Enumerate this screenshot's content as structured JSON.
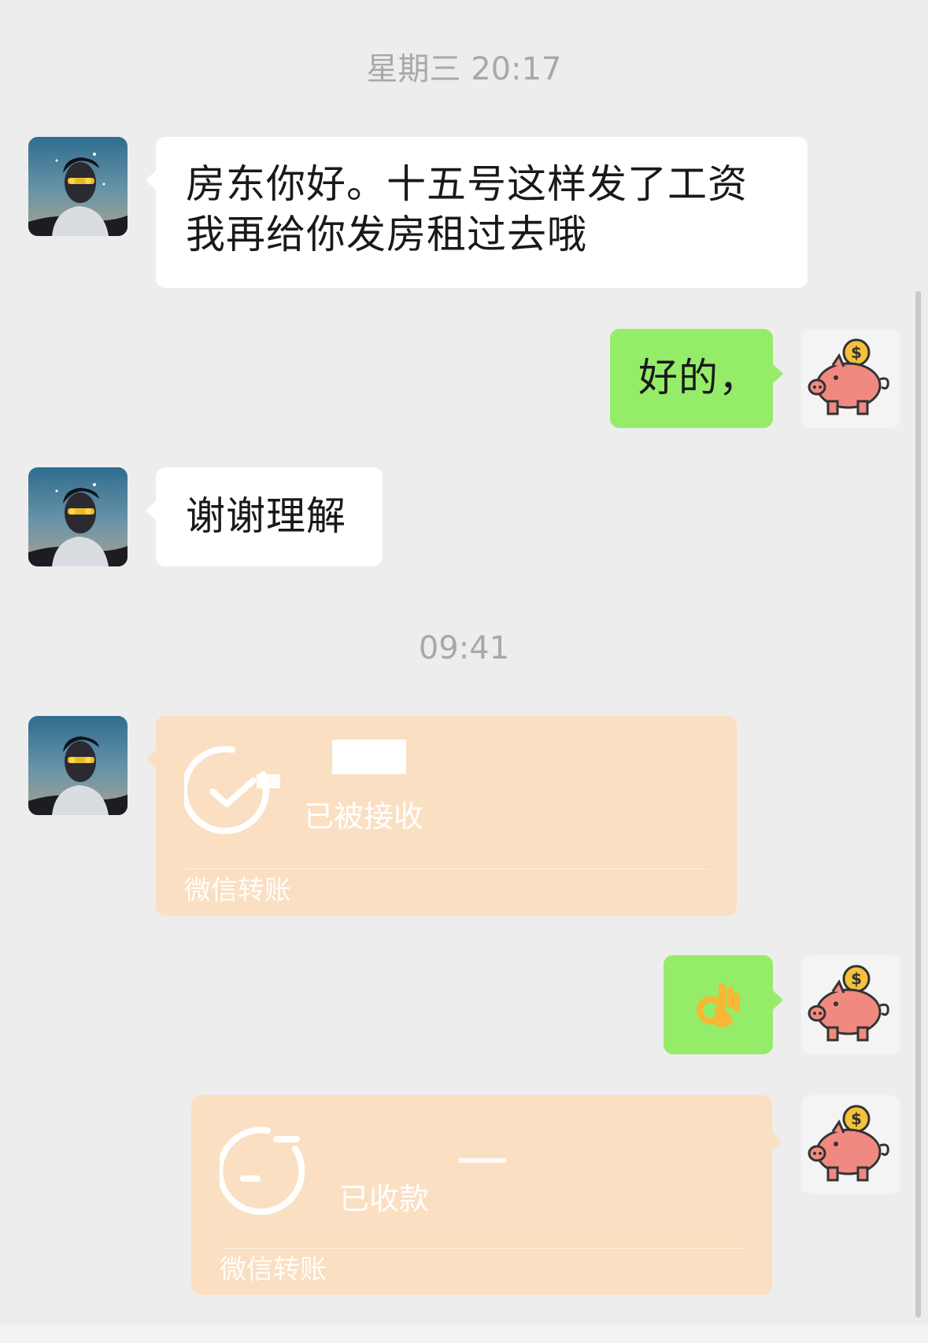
{
  "chat": {
    "timestamps": {
      "first": "星期三 20:17",
      "second": "09:41"
    },
    "messages": {
      "m1": {
        "sender": "landlord",
        "text_line1": "房东你好。十五号这样发了工资",
        "text_line2": "我再给你发房租过去哦"
      },
      "m2": {
        "sender": "self",
        "text": "好的，"
      },
      "m3": {
        "sender": "landlord",
        "text": "谢谢理解"
      },
      "m4": {
        "sender": "landlord",
        "type": "transfer",
        "status": "已被接收",
        "footer": "微信转账",
        "icon": "check-circle-icon"
      },
      "m5": {
        "sender": "self",
        "type": "emoji",
        "emoji": "👌",
        "icon": "ok-hand-icon"
      },
      "m6": {
        "sender": "self",
        "type": "transfer",
        "status": "已收款",
        "footer": "微信转账",
        "icon": "refresh-circle-icon"
      }
    }
  },
  "avatars": {
    "landlord": {
      "icon": "person-silhouette-avatar"
    },
    "self": {
      "icon": "piggy-bank-avatar"
    }
  },
  "colors": {
    "background": "#ededed",
    "bubble_self": "#95ec69",
    "bubble_other": "#ffffff",
    "transfer_card": "#fbdfc2",
    "timestamp_text": "#a8a8a8"
  }
}
